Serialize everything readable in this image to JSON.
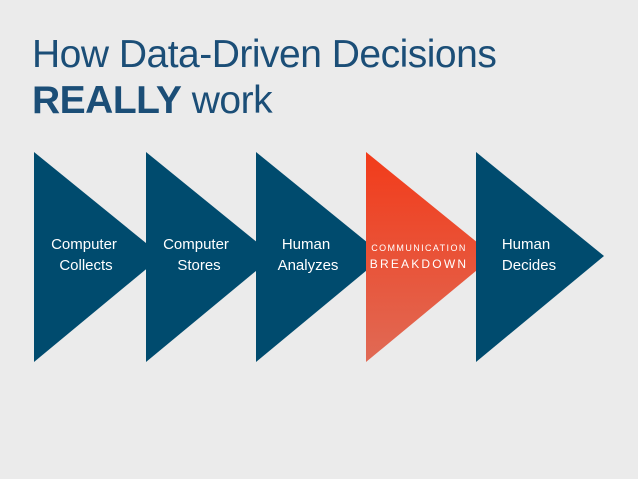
{
  "title": {
    "line1": "How Data-Driven Decisions",
    "line2_bold": "REALLY",
    "line2_rest": " work"
  },
  "colors": {
    "background": "#ebebeb",
    "arrow": "#004b6e",
    "highlight_top": "#f23b1a",
    "highlight_bottom": "#e06a55",
    "title": "#1b4e77"
  },
  "steps": [
    {
      "line1": "Computer",
      "line2": "Collects"
    },
    {
      "line1": "Computer",
      "line2": "Stores"
    },
    {
      "line1": "Human",
      "line2": "Analyzes"
    },
    {
      "line1": "COMMUNICATION",
      "line2": "BREAKDOWN"
    },
    {
      "line1": "Human",
      "line2": "Decides"
    }
  ]
}
